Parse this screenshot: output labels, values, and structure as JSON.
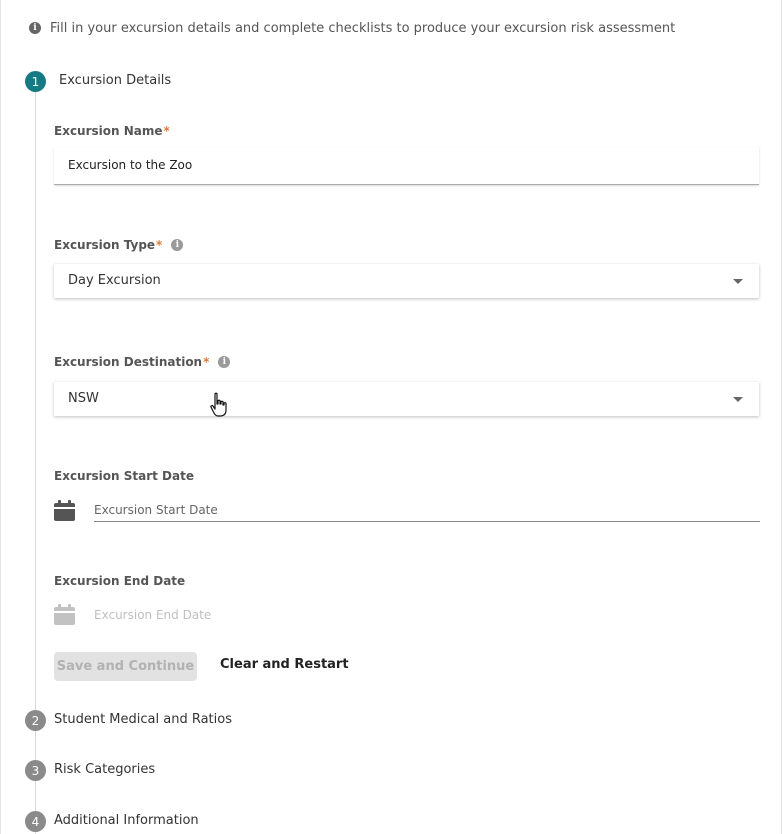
{
  "intro": {
    "text": "Fill in your excursion details and complete checklists to produce your excursion risk assessment",
    "icon": "info-icon"
  },
  "steps": [
    {
      "number": "1",
      "label": "Excursion Details",
      "state": "active"
    },
    {
      "number": "2",
      "label": "Student Medical and Ratios",
      "state": "inactive"
    },
    {
      "number": "3",
      "label": "Risk Categories",
      "state": "inactive"
    },
    {
      "number": "4",
      "label": "Additional Information",
      "state": "inactive"
    }
  ],
  "form": {
    "required_mark": "*",
    "name": {
      "label": "Excursion Name",
      "value": "Excursion to the Zoo"
    },
    "type": {
      "label": "Excursion Type",
      "value": "Day Excursion"
    },
    "destination": {
      "label": "Excursion Destination",
      "value": "NSW"
    },
    "start_date": {
      "label": "Excursion Start Date",
      "placeholder": "Excursion Start Date"
    },
    "end_date": {
      "label": "Excursion End Date",
      "placeholder": "Excursion End Date"
    }
  },
  "actions": {
    "save": "Save and Continue",
    "clear": "Clear and Restart"
  },
  "colors": {
    "active_step": "#147a84",
    "inactive_step": "#8a8a8a",
    "required": "#e07a3a"
  }
}
